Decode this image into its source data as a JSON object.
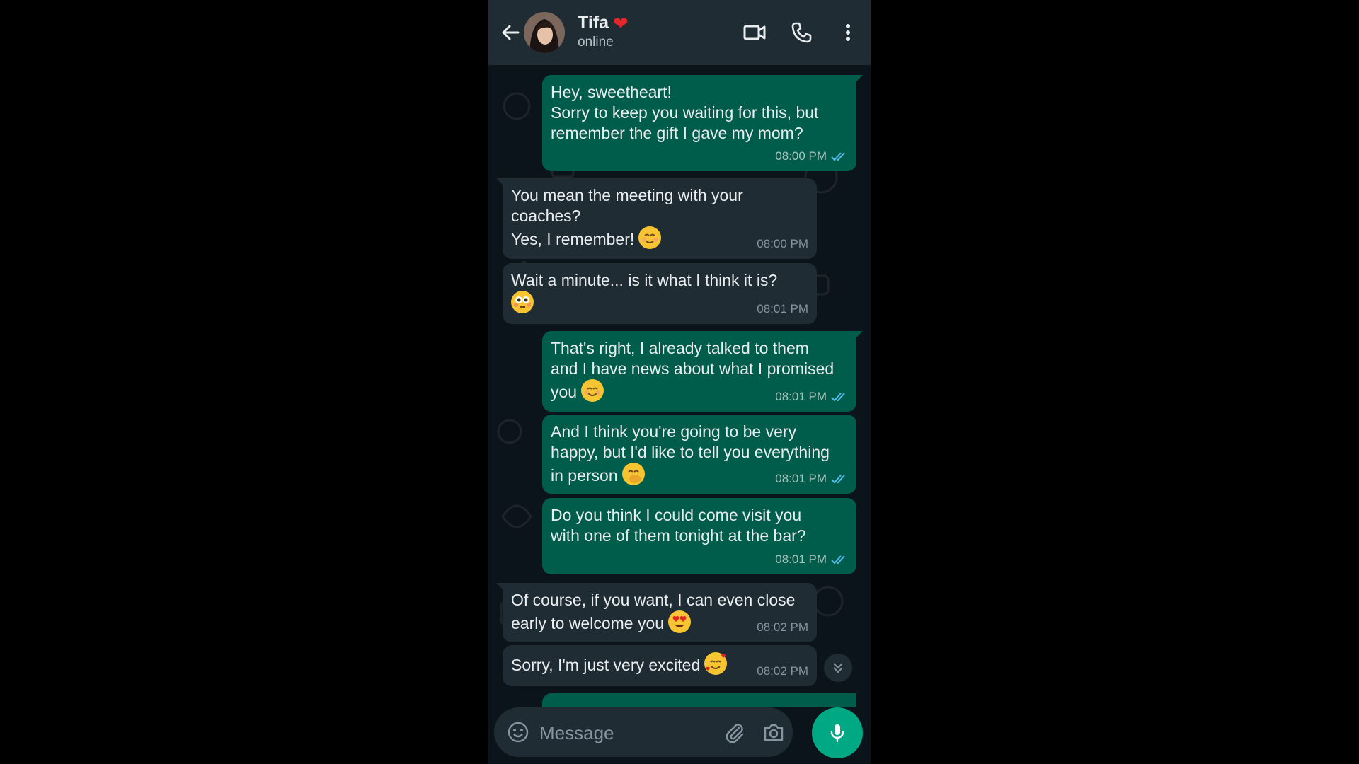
{
  "header": {
    "contact_name": "Tifa",
    "heart": "❤",
    "status": "online"
  },
  "messages": [
    {
      "direction": "out",
      "lines": [
        "Hey, sweetheart!",
        "Sorry to keep you waiting for this, but",
        "remember the gift I gave my mom?"
      ],
      "emoji": "",
      "time": "08:00 PM",
      "read": true
    },
    {
      "direction": "in",
      "lines": [
        "You mean the meeting with your",
        "coaches?",
        "Yes, I remember!"
      ],
      "emoji": "relieved-face",
      "time": "08:00 PM"
    },
    {
      "direction": "in",
      "lines": [
        "Wait a minute... is it what I think it is?"
      ],
      "emoji": "flushed-face",
      "time": "08:01 PM"
    },
    {
      "direction": "out",
      "lines": [
        "That's right, I already talked to them",
        "and I have news about what I promised",
        "you"
      ],
      "emoji": "smiling-face",
      "time": "08:01 PM",
      "read": true
    },
    {
      "direction": "out",
      "lines": [
        "And I think you're going to be very",
        "happy, but I'd like to tell you everything",
        "in person"
      ],
      "emoji": "hand-over-mouth-face",
      "time": "08:01 PM",
      "read": true
    },
    {
      "direction": "out",
      "lines": [
        "Do you think I could come visit you",
        "with one of them tonight at the bar?"
      ],
      "emoji": "",
      "time": "08:01 PM",
      "read": true
    },
    {
      "direction": "in",
      "lines": [
        "Of course, if you want, I can even close",
        "early to welcome you"
      ],
      "emoji": "heart-eyes-face",
      "time": "08:02 PM"
    },
    {
      "direction": "in",
      "lines": [
        "Sorry, I'm just very excited"
      ],
      "emoji": "smiling-face-with-hearts",
      "time": "08:02 PM"
    }
  ],
  "composer": {
    "placeholder": "Message"
  },
  "colors": {
    "outgoing_bubble": "#005c4b",
    "incoming_bubble": "#1f2c34",
    "accent": "#00a884",
    "read_ticks": "#53bdeb",
    "background": "#0b141a"
  }
}
